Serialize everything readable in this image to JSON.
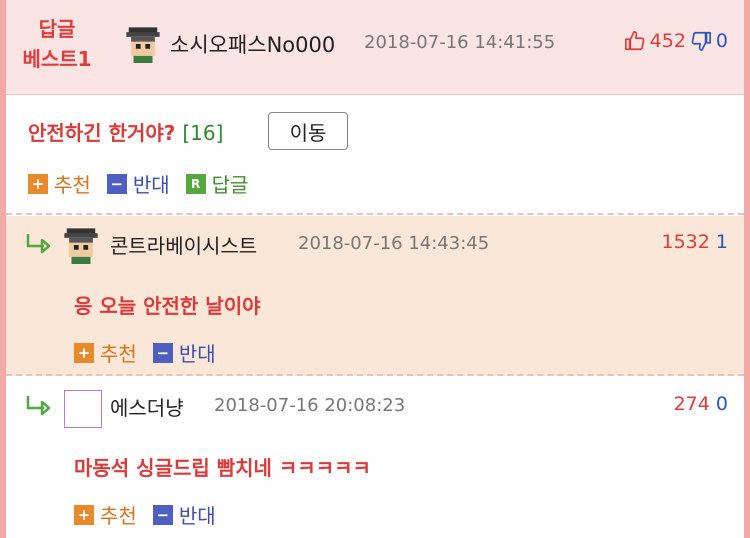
{
  "best": {
    "label_line1": "답글",
    "label_line2": "베스트1",
    "nick": "소시오패스No000",
    "date": "2018-07-16 14:41:55",
    "up": "452",
    "down": "0",
    "title": "안전하긴 한거야?",
    "reply_count": "[16]",
    "move_label": "이동",
    "actions": {
      "recommend": "추천",
      "oppose": "반대",
      "reply": "답글",
      "reply_badge": "R"
    }
  },
  "replies": [
    {
      "nick": "콘트라베이시스트",
      "date": "2018-07-16 14:43:45",
      "up": "1532",
      "down": "1",
      "text": "응 오늘 안전한 날이야",
      "recommend": "추천",
      "oppose": "반대"
    },
    {
      "nick": "에스더냥",
      "date": "2018-07-16 20:08:23",
      "up": "274",
      "down": "0",
      "text": "마동석 싱글드립 빰치네 ㅋㅋㅋㅋㅋ",
      "recommend": "추천",
      "oppose": "반대"
    }
  ],
  "colors": {
    "accent": "#e03c3c",
    "border": "#f4a9a9",
    "reply_bg": "#fbe7d7",
    "best_bg": "#fbe4e4"
  },
  "icons": {
    "up": "thumbs-up-icon",
    "down": "thumbs-down-icon",
    "arrow": "reply-arrow-icon",
    "avatar": "pixel-avatar-icon"
  }
}
